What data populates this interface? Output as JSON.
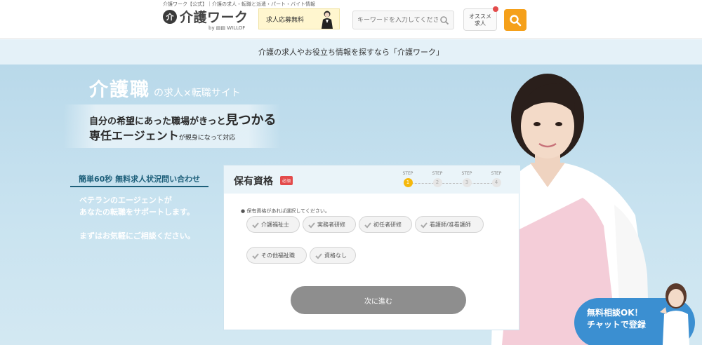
{
  "header": {
    "tagline": "介護ワーク【公式】｜介護の求人・転職と派遣・パート・バイト情報",
    "logo_mark": "介",
    "logo_text": "介護ワーク",
    "logo_sub": "by ▤▤ WILLOF",
    "banner_label": "求人応募無料",
    "search_placeholder": "キーワードを入力してください",
    "recommend_line1": "オススメ",
    "recommend_line2": "求人"
  },
  "subheader": {
    "text": "介護の求人やお役立ち情報を探すなら「介護ワーク」"
  },
  "hero": {
    "title_main": "介護職",
    "title_sub": "の求人×転職サイト",
    "line1_a": "自分の希望にあった職場がきっと",
    "line1_b": "見つかる",
    "line2_a": "専任エージェント",
    "line2_b": "が親身になって対応",
    "left_head": "簡単60秒 無料求人状況問い合わせ",
    "left_text1": "ベテランのエージェントが",
    "left_text2": "あなたの転職をサポートします。",
    "left_text3": "まずはお気軽にご相談ください。"
  },
  "form": {
    "title": "保有資格",
    "required": "必須",
    "step_label": "STEP",
    "steps": [
      "1",
      "2",
      "3",
      "4"
    ],
    "hint": "保有資格があれば選択してください。",
    "options": [
      "介護福祉士",
      "実務者研修",
      "初任者研修",
      "看護師/准看護師",
      "その他福祉職",
      "資格なし"
    ],
    "next": "次に進む"
  },
  "chat": {
    "line1": "無料相談OK！",
    "line2": "チャットで登録"
  },
  "colors": {
    "accent": "#f5a01a",
    "step_active": "#f5b80b",
    "required": "#e34b4b",
    "chat": "#3b8fd1",
    "hero_bg": "#c9e3f0"
  }
}
